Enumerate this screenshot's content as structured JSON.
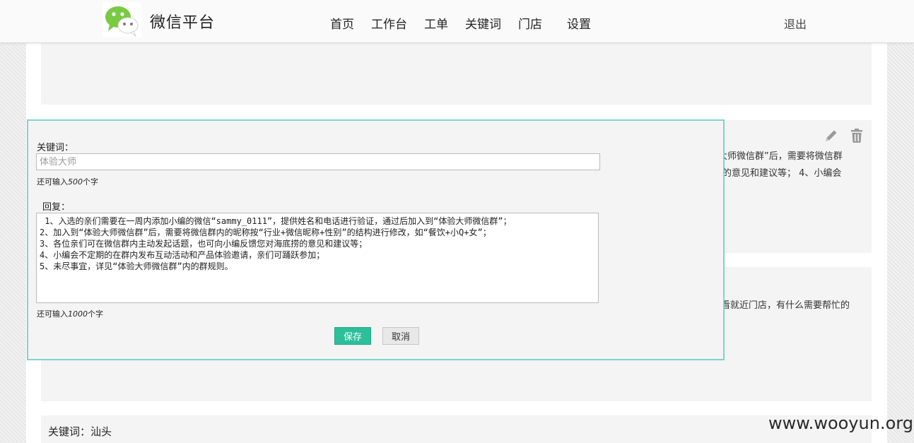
{
  "header": {
    "brand": "微信平台",
    "nav": [
      "首页",
      "工作台",
      "工单",
      "关键词",
      "门店",
      "设置"
    ],
    "logout": "退出"
  },
  "edit_panel": {
    "keyword_label": "关键词：",
    "keyword_placeholder": "体验大师",
    "keyword_hint_prefix": "还可输入",
    "keyword_hint_count": "500",
    "keyword_hint_suffix": "个字",
    "reply_label": "回复：",
    "reply_text": " 1、入选的亲们需要在一周内添加小编的微信“sammy_0111”，提供姓名和电话进行验证，通过后加入到“体验大师微信群”；\n2、加入到“体验大师微信群”后，需要将微信群内的昵称按“行业+微信昵称+性别”的结构进行修改，如“餐饮+小Q+女”；\n3、各位亲们可在微信群内主动发起话题，也可向小编反馈您对海底捞的意见和建议等；\n4、小编会不定期的在群内发布互动活动和产品体验邀请，亲们可踊跃参加；\n5、未尽事宜，详见“体验大师微信群”内的群规则。",
    "reply_hint_prefix": "还可输入",
    "reply_hint_count": "1000",
    "reply_hint_suffix": "个字",
    "save_label": "保存",
    "cancel_label": "取消"
  },
  "background_cards": {
    "card2_line1": "大师微信群”后，需要将微信群",
    "card2_line2": "的意见和建议等； 4、小编会",
    "card3_line1": "看就近门店，有什么需要帮忙的",
    "card4_label": "关键词：汕头"
  },
  "watermark": "www.wooyun.org",
  "colors": {
    "accent": "#2bbf9a",
    "panel_border": "#7fd3cd",
    "logo_green": "#7ac943"
  },
  "icons": {
    "logo": "wechat-logo-icon",
    "edit": "pencil-icon",
    "delete": "trash-icon"
  }
}
